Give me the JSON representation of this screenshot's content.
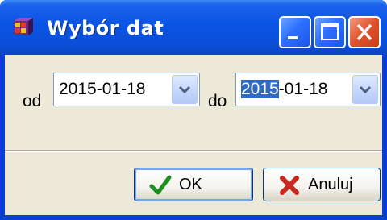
{
  "window": {
    "title": "Wybór dat"
  },
  "titlebar_buttons": {
    "minimize": "minimize",
    "maximize": "maximize",
    "close": "close"
  },
  "form": {
    "from_label": "od",
    "from_value": "2015-01-18",
    "to_label": "do",
    "to_value_selected": "2015",
    "to_value_rest": "-01-18"
  },
  "buttons": {
    "ok_label": "OK",
    "cancel_label": "Anuluj"
  },
  "colors": {
    "titlebar": "#0a54e3",
    "client": "#ece9d8",
    "selection": "#316ac5",
    "close_button": "#e0522c"
  },
  "icons": {
    "app": "app-cube-icon",
    "ok": "checkmark-icon",
    "cancel": "red-x-icon",
    "dropdown": "chevron-down-icon"
  }
}
